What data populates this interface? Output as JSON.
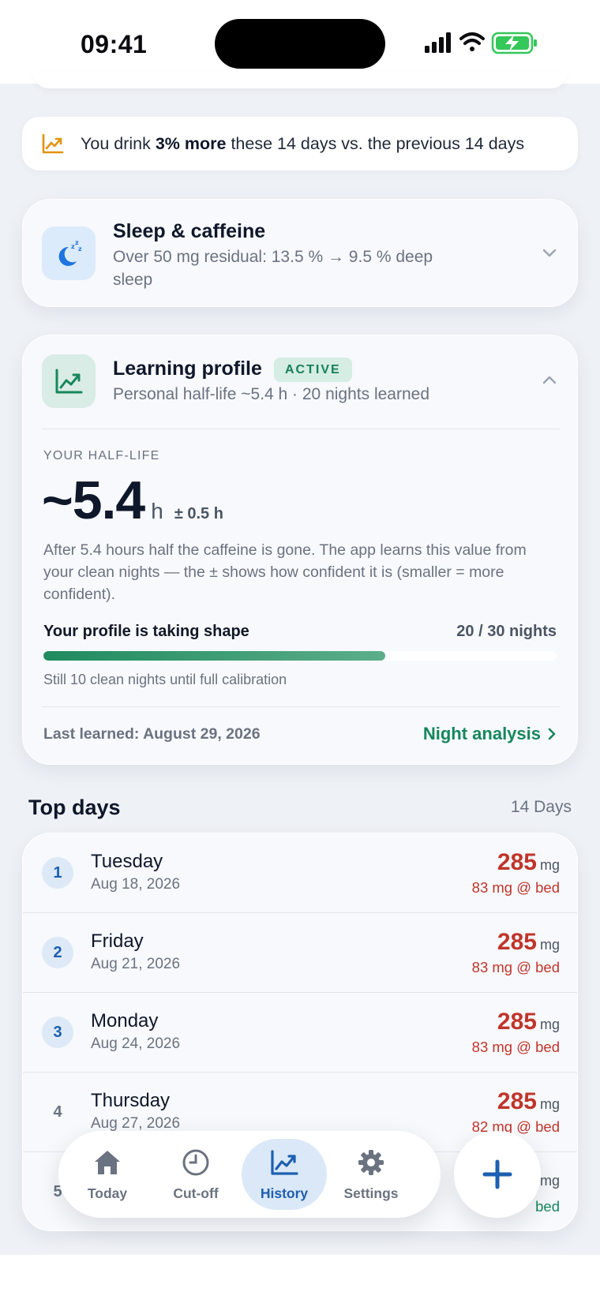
{
  "status_bar": {
    "time": "09:41"
  },
  "banner": {
    "text_before": "You drink ",
    "text_bold": "3% more",
    "text_after": " these 14 days vs. the previous 14 days",
    "accent": "#e3930f"
  },
  "sleep_card": {
    "title": "Sleep & caffeine",
    "subtitle": "Over 50 mg residual: 13.5 % → 9.5 % deep sleep",
    "icon": "moon-sleep-icon",
    "accent": "#1f74e0"
  },
  "learning_card": {
    "title": "Learning profile",
    "badge": "ACTIVE",
    "subtitle": "Personal half-life ~5.4 h · 20 nights learned",
    "eyebrow": "YOUR HALF-LIFE",
    "value": "~5.4",
    "unit": "h",
    "uncertainty": "± 0.5 h",
    "description": "After 5.4 hours half the caffeine is gone. The app learns this value from your clean nights — the ± shows how confident it is (smaller = more confident).",
    "progress": {
      "label": "Your profile is taking shape",
      "count_label": "20 / 30 nights",
      "current": 20,
      "total": 30,
      "note": "Still 10 clean nights until full calibration"
    },
    "last_learned": "Last learned: August 29, 2026",
    "link": "Night analysis",
    "accent": "#16875c"
  },
  "top_days": {
    "title": "Top days",
    "range": "14 Days",
    "unit": "mg",
    "rows": [
      {
        "rank": "1",
        "day": "Tuesday",
        "date": "Aug 18, 2026",
        "amount": "285",
        "at_bed": "83 mg @ bed"
      },
      {
        "rank": "2",
        "day": "Friday",
        "date": "Aug 21, 2026",
        "amount": "285",
        "at_bed": "83 mg @ bed"
      },
      {
        "rank": "3",
        "day": "Monday",
        "date": "Aug 24, 2026",
        "amount": "285",
        "at_bed": "83 mg @ bed"
      },
      {
        "rank": "4",
        "day": "Thursday",
        "date": "Aug 27, 2026",
        "amount": "285",
        "at_bed": "82 mg @ bed"
      },
      {
        "rank": "5",
        "day": "",
        "date": "",
        "amount": "",
        "at_bed": "bed"
      }
    ]
  },
  "tab_bar": {
    "tabs": [
      {
        "label": "Today",
        "icon": "home-icon"
      },
      {
        "label": "Cut-off",
        "icon": "clock-icon"
      },
      {
        "label": "History",
        "icon": "chart-icon",
        "active": true
      },
      {
        "label": "Settings",
        "icon": "gear-icon"
      }
    ],
    "add_icon": "plus-icon",
    "active_color": "#1d5fb0"
  }
}
